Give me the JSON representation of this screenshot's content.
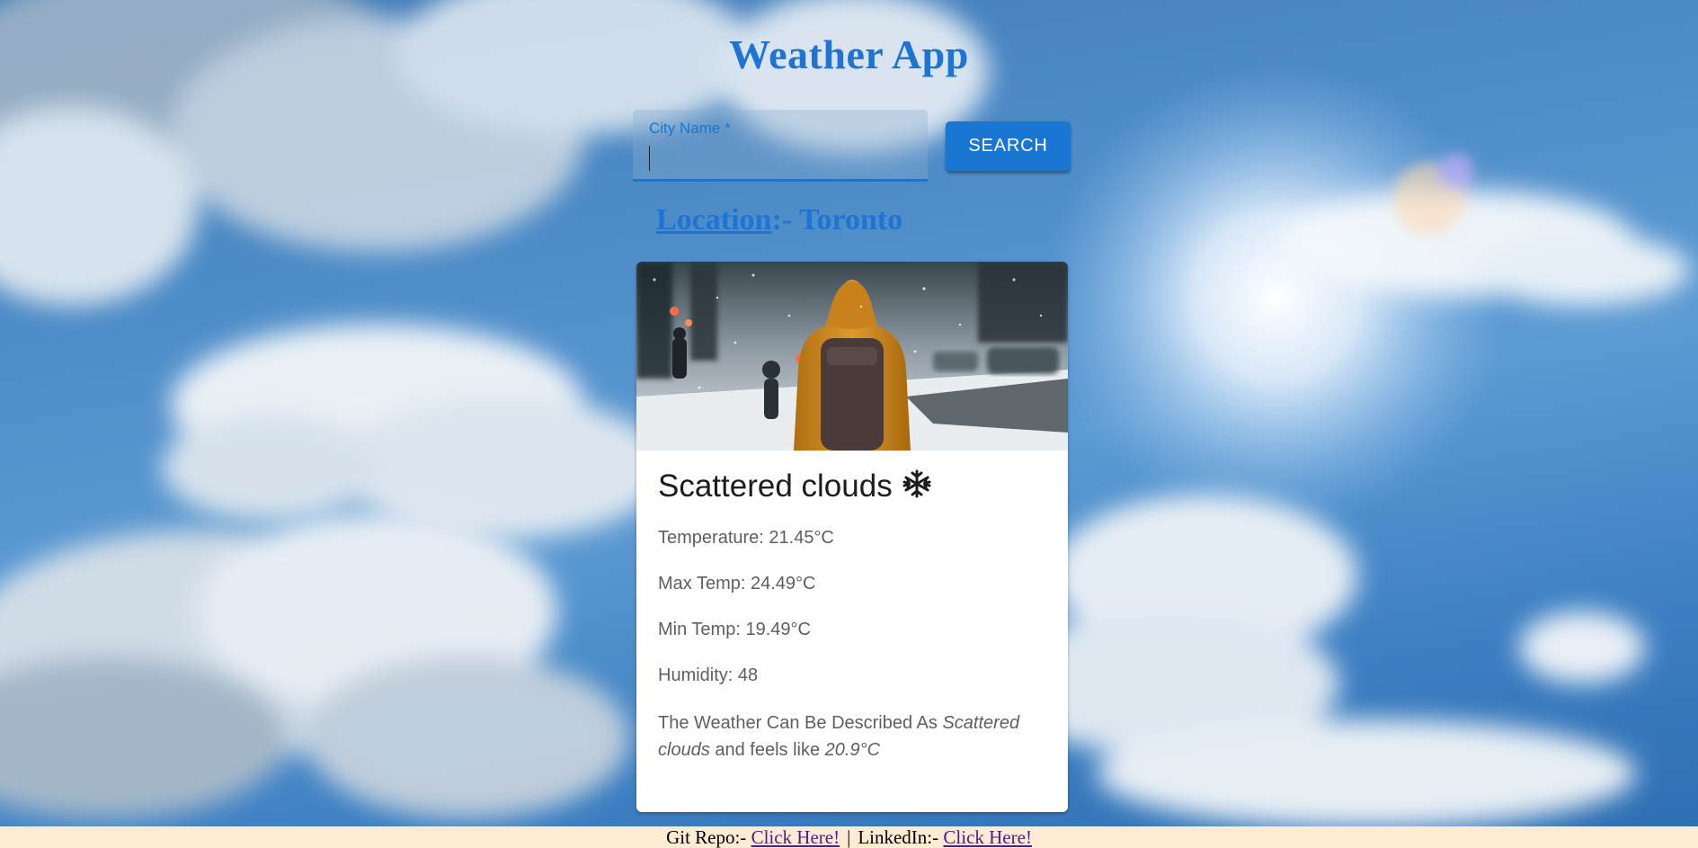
{
  "header": {
    "title": "Weather App"
  },
  "search": {
    "label": "City Name *",
    "value": "",
    "button_label": "SEARCH"
  },
  "location": {
    "label": "Location",
    "separator": ":- ",
    "city": "Toronto"
  },
  "card": {
    "image_description": "person-in-snow-photo",
    "condition": "Scattered clouds",
    "condition_icon": "snowflake-icon",
    "temperature": "Temperature: 21.45°C",
    "max_temp": "Max Temp: 24.49°C",
    "min_temp": "Min Temp: 19.49°C",
    "humidity": "Humidity: 48",
    "description_prefix": "The Weather Can Be Described As ",
    "description_condition": "Scattered clouds",
    "description_middle": " and feels like ",
    "description_feels_like": "20.9°C"
  },
  "footer": {
    "git_label": "Git Repo:- ",
    "git_link": "Click Here!",
    "separator": "|",
    "linkedin_label": "LinkedIn:- ",
    "linkedin_link": "Click Here!"
  },
  "colors": {
    "accent": "#1976d2",
    "title": "#1e74d2",
    "footer_bg": "#fdebd3",
    "link_visited": "#551a8b"
  }
}
